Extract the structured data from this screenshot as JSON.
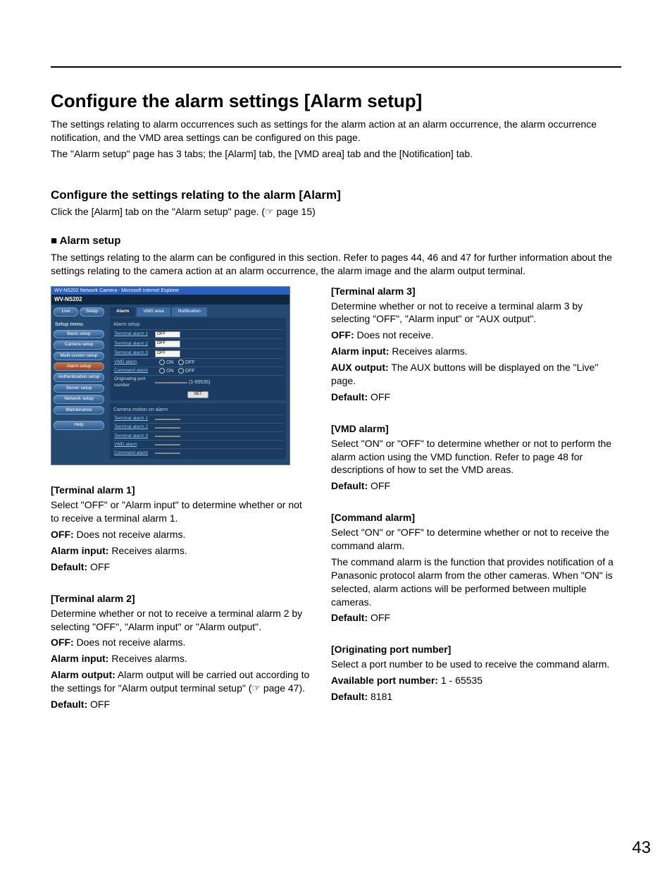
{
  "page_number": "43",
  "h1": "Configure the alarm settings [Alarm setup]",
  "intro1": "The settings relating to alarm occurrences such as settings for the alarm action at an alarm occurrence, the alarm occurrence notification, and the VMD area settings can be configured on this page.",
  "intro2": "The \"Alarm setup\" page has 3 tabs; the [Alarm] tab, the [VMD area] tab and the [Notification] tab.",
  "h2": "Configure the settings relating to the alarm [Alarm]",
  "p_click": "Click the [Alarm] tab on the \"Alarm setup\" page. (☞ page 15)",
  "h3": "■ Alarm setup",
  "p_alarmsetup": "The settings relating to the alarm can be configured in this section. Refer to pages 44, 46 and 47 for further information about the settings relating to the camera action at an alarm occurrence, the alarm image and the alarm output terminal.",
  "shot": {
    "titlebar": "WV-NS202 Network Camera - Microsoft Internet Explorer",
    "model": "WV-NS202",
    "side": {
      "live": "Live",
      "setup": "Setup",
      "menu": "Setup menu",
      "items": [
        "Basic setup",
        "Camera setup",
        "Multi-screen setup",
        "Alarm setup",
        "Authentication setup",
        "Server setup",
        "Network setup",
        "Maintenance"
      ],
      "help": "Help"
    },
    "tabs": [
      "Alarm",
      "VMD area",
      "Notification"
    ],
    "panel1_title": "Alarm setup",
    "rows1": [
      {
        "k": "Terminal alarm 1",
        "type": "sel",
        "v": "OFF"
      },
      {
        "k": "Terminal alarm 2",
        "type": "sel",
        "v": "OFF"
      },
      {
        "k": "Terminal alarm 3",
        "type": "sel",
        "v": "OFF"
      },
      {
        "k": "VMD alarm",
        "type": "radio",
        "on": "ON",
        "off": "OFF"
      },
      {
        "k": "Command alarm",
        "type": "radio",
        "on": "ON",
        "off": "OFF",
        "extra_k": "Originating port number",
        "extra_v": "(1-65535)"
      }
    ],
    "set": "SET",
    "panel2_title": "Camera motion on alarm",
    "rows2": [
      {
        "k": "Terminal alarm 1"
      },
      {
        "k": "Terminal alarm 2"
      },
      {
        "k": "Terminal alarm 3"
      },
      {
        "k": "VMD alarm"
      },
      {
        "k": "Command alarm"
      }
    ]
  },
  "left": {
    "t1": {
      "title": "[Terminal alarm 1]",
      "body": "Select \"OFF\" or \"Alarm input\" to determine whether or not to receive a terminal alarm 1.",
      "off": "OFF:",
      "off_v": " Does not receive alarms.",
      "ai": "Alarm input:",
      "ai_v": " Receives alarms.",
      "def": "Default:",
      "def_v": " OFF"
    },
    "t2": {
      "title": "[Terminal alarm 2]",
      "body": "Determine whether or not to receive a terminal alarm 2 by selecting \"OFF\", \"Alarm input\" or \"Alarm output\".",
      "off": "OFF:",
      "off_v": " Does not receive alarms.",
      "ai": "Alarm input:",
      "ai_v": " Receives alarms.",
      "ao": "Alarm output:",
      "ao_v": " Alarm output will be carried out according to the settings for \"Alarm output terminal setup\" (☞ page 47).",
      "def": "Default:",
      "def_v": " OFF"
    }
  },
  "right": {
    "t3": {
      "title": "[Terminal alarm 3]",
      "body": "Determine whether or not to receive a terminal alarm 3 by selecting \"OFF\", \"Alarm input\" or \"AUX output\".",
      "off": "OFF:",
      "off_v": " Does not receive.",
      "ai": "Alarm input:",
      "ai_v": " Receives alarms.",
      "ax": "AUX output:",
      "ax_v": " The AUX buttons will be displayed on the \"Live\" page.",
      "def": "Default:",
      "def_v": " OFF"
    },
    "vmd": {
      "title": "[VMD alarm]",
      "body": "Select \"ON\" or \"OFF\" to determine whether or not to perform the alarm action using the VMD function. Refer to page 48 for descriptions of how to set the VMD areas.",
      "def": "Default:",
      "def_v": " OFF"
    },
    "cmd": {
      "title": "[Command alarm]",
      "body1": "Select \"ON\" or \"OFF\" to determine whether or not to receive the command alarm.",
      "body2": "The command alarm is the function that provides notification of a Panasonic protocol alarm from the other cameras. When \"ON\" is selected, alarm actions will be performed between multiple cameras.",
      "def": "Default:",
      "def_v": " OFF"
    },
    "port": {
      "title": "[Originating port number]",
      "body": "Select a port number to be used to receive the command alarm.",
      "apn": "Available port number:",
      "apn_v": " 1 - 65535",
      "def": "Default:",
      "def_v": " 8181"
    }
  }
}
